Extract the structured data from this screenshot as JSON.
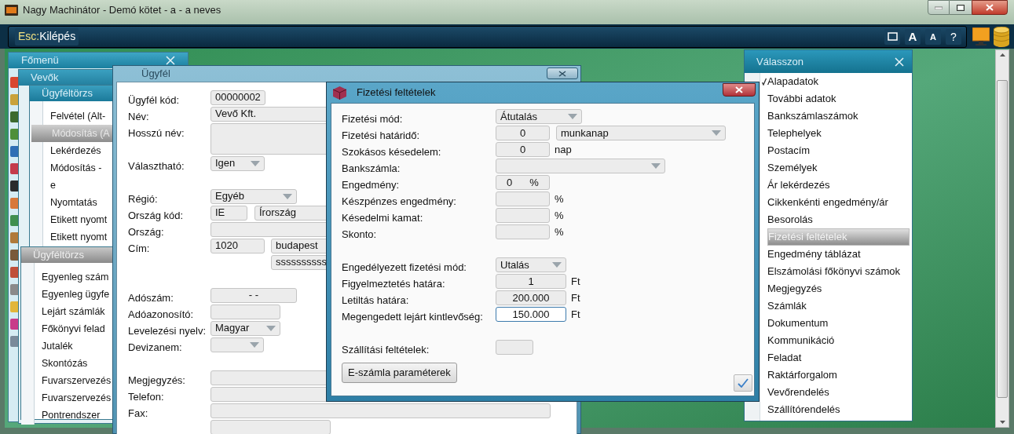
{
  "window": {
    "title": "Nagy Machinátor - Demó kötet - a - a neves"
  },
  "toolbar": {
    "exit": {
      "key": "Esc:",
      "label": "Kilépés"
    },
    "buttons": [
      {
        "kind": "window"
      },
      {
        "kind": "font_up",
        "label": "A"
      },
      {
        "kind": "font_down",
        "label": "A"
      },
      {
        "kind": "help",
        "label": "?"
      }
    ]
  },
  "main_menu": {
    "title": "Főmenü",
    "section": "Vevők",
    "groups": [
      {
        "title": "Ügyféltörzs",
        "active": true,
        "items": [
          {
            "label": "Felvétel (Alt-",
            "selected": false
          },
          {
            "label": "Módosítás (A",
            "selected": true
          },
          {
            "label": "Lekérdezés",
            "selected": false
          },
          {
            "label": "Módosítás -",
            "selected": false
          },
          {
            "label": "e",
            "selected": false
          },
          {
            "label": "Nyomtatás",
            "selected": false
          },
          {
            "label": "Etikett nyomt",
            "selected": false
          },
          {
            "label": "Etikett nyomt",
            "selected": false
          }
        ]
      },
      {
        "title": "Ügyféltörzs",
        "active": false,
        "items": [
          {
            "label": "Egyenleg szám",
            "selected": false
          },
          {
            "label": "Egyenleg ügyfe",
            "selected": false
          },
          {
            "label": "Lejárt számlák",
            "selected": false
          },
          {
            "label": "Főkönyvi felad",
            "selected": false
          },
          {
            "label": "Jutalék",
            "selected": false
          },
          {
            "label": "Skontózás",
            "selected": false
          },
          {
            "label": "Fuvarszervezés",
            "selected": false
          },
          {
            "label": "Fuvarszervezés",
            "selected": false
          },
          {
            "label": "Pontrendszer",
            "selected": false
          }
        ]
      }
    ]
  },
  "customer": {
    "title": "Ügyfél",
    "groups": [
      {
        "fields": [
          {
            "label": "Ügyfél kód:",
            "inputs": [
              {
                "kind": "text",
                "value": "00000002"
              }
            ]
          },
          {
            "label": "Név:",
            "inputs": [
              {
                "kind": "text",
                "value": "Vevő Kft."
              }
            ]
          },
          {
            "label": "Hosszú név:",
            "inputs": [
              {
                "kind": "textarea"
              }
            ]
          },
          {
            "label": "Választható:",
            "inputs": [
              {
                "kind": "dropdown",
                "value": "Igen"
              }
            ]
          }
        ]
      },
      {
        "fields": [
          {
            "label": "Régió:",
            "inputs": [
              {
                "kind": "dropdown",
                "value": "Egyéb"
              }
            ]
          },
          {
            "label": "Ország kód:",
            "inputs": [
              {
                "kind": "text",
                "value": "IE"
              },
              {
                "kind": "text",
                "value": "Írország"
              }
            ]
          },
          {
            "label": "Ország:",
            "inputs": [
              {
                "kind": "text"
              }
            ]
          },
          {
            "label": "Cím:",
            "inputs": [
              {
                "kind": "text",
                "value": "1020"
              },
              {
                "kind": "text",
                "value": "budapest"
              }
            ]
          },
          {
            "inputs": [
              {
                "kind": "text",
                "value": "ssssssssss"
              }
            ]
          }
        ]
      },
      {
        "fields": [
          {
            "label": "Adószám:",
            "inputs": [
              {
                "kind": "text",
                "value": "- -"
              }
            ]
          },
          {
            "label": "Adóazonosító:",
            "inputs": [
              {
                "kind": "text"
              }
            ]
          },
          {
            "label": "Levelezési nyelv:",
            "inputs": [
              {
                "kind": "dropdown",
                "value": "Magyar"
              }
            ]
          },
          {
            "label": "Devizanem:",
            "inputs": [
              {
                "kind": "dropdown"
              }
            ]
          }
        ]
      },
      {
        "fields": [
          {
            "label": "Megjegyzés:",
            "inputs": [
              {
                "kind": "text"
              }
            ]
          },
          {
            "label": "Telefon:",
            "inputs": [
              {
                "kind": "text"
              }
            ]
          },
          {
            "label": "Fax:",
            "inputs": [
              {
                "kind": "text"
              }
            ]
          },
          {
            "inputs": [
              {
                "kind": "text"
              }
            ]
          }
        ]
      }
    ]
  },
  "payment": {
    "title": "Fizetési feltételek",
    "groups": [
      {
        "rows": [
          {
            "label": "Fizetési mód:",
            "inputs": [
              {
                "kind": "dropdown",
                "value": "Átutalás"
              }
            ]
          },
          {
            "label": "Fizetési határidő:",
            "inputs": [
              {
                "kind": "number",
                "value": "0",
                "focused": false
              },
              {
                "kind": "dropdown",
                "value": "munkanap"
              }
            ]
          },
          {
            "label": "Szokásos késedelem:",
            "inputs": [
              {
                "kind": "number",
                "value": "0",
                "focused": false
              }
            ],
            "unit": "nap"
          },
          {
            "label": "Bankszámla:",
            "inputs": [
              {
                "kind": "dropdown"
              }
            ]
          },
          {
            "label": "Engedmény:",
            "inputs": [
              {
                "kind": "number",
                "value": "0",
                "suffix": "%",
                "focused": false
              }
            ]
          },
          {
            "label": "Készpénzes engedmény:",
            "inputs": [
              {
                "kind": "number",
                "focused": false
              }
            ],
            "unit": "%"
          },
          {
            "label": "Késedelmi kamat:",
            "inputs": [
              {
                "kind": "number",
                "focused": false
              }
            ],
            "unit": "%"
          },
          {
            "label": "Skonto:",
            "inputs": [
              {
                "kind": "number",
                "focused": false
              }
            ],
            "unit": "%"
          }
        ]
      },
      {
        "rows": [
          {
            "label": "Engedélyezett fizetési mód:",
            "inputs": [
              {
                "kind": "dropdown",
                "value": "Utalás"
              }
            ]
          },
          {
            "label": "Figyelmeztetés határa:",
            "inputs": [
              {
                "kind": "number",
                "value": "1",
                "focused": false
              }
            ],
            "unit": "Ft"
          },
          {
            "label": "Letiltás határa:",
            "inputs": [
              {
                "kind": "number",
                "value": "200.000",
                "focused": false
              }
            ],
            "unit": "Ft"
          },
          {
            "label": "Megengedett lejárt kintlevőség:",
            "inputs": [
              {
                "kind": "number",
                "value": "150.000",
                "focused": true
              }
            ],
            "unit": "Ft"
          }
        ]
      },
      {
        "rows": [
          {
            "label": "Szállítási feltételek:",
            "inputs": [
              {
                "kind": "number",
                "focused": false
              }
            ]
          }
        ]
      }
    ],
    "button": "E-számla paraméterek"
  },
  "chooser": {
    "title": "Válasszon",
    "items": [
      {
        "label": "Alapadatok",
        "selected": false,
        "checked": true
      },
      {
        "label": "További adatok",
        "selected": false,
        "checked": false
      },
      {
        "label": "Bankszámlaszámok",
        "selected": false,
        "checked": false
      },
      {
        "label": "Telephelyek",
        "selected": false,
        "checked": false
      },
      {
        "label": "Postacím",
        "selected": false,
        "checked": false
      },
      {
        "label": "Személyek",
        "selected": false,
        "checked": false
      },
      {
        "label": "Ár lekérdezés",
        "selected": false,
        "checked": false
      },
      {
        "label": "Cikkenkénti engedmény/ár",
        "selected": false,
        "checked": false
      },
      {
        "label": "Besorolás",
        "selected": false,
        "checked": false
      },
      {
        "label": "Fizetési feltételek",
        "selected": true,
        "checked": false
      },
      {
        "label": "Engedmény táblázat",
        "selected": false,
        "checked": false
      },
      {
        "label": "Elszámolási főkönyvi számok",
        "selected": false,
        "checked": false
      },
      {
        "label": "Megjegyzés",
        "selected": false,
        "checked": false
      },
      {
        "label": "Számlák",
        "selected": false,
        "checked": false
      },
      {
        "label": "Dokumentum",
        "selected": false,
        "checked": false
      },
      {
        "label": "Kommunikáció",
        "selected": false,
        "checked": false
      },
      {
        "label": "Feladat",
        "selected": false,
        "checked": false
      },
      {
        "label": "Raktárforgalom",
        "selected": false,
        "checked": false
      },
      {
        "label": "Vevőrendelés",
        "selected": false,
        "checked": false
      },
      {
        "label": "Szállítórendelés",
        "selected": false,
        "checked": false
      }
    ]
  }
}
